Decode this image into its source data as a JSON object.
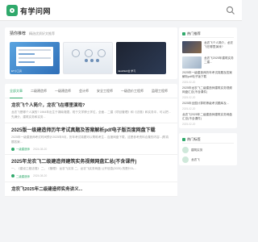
{
  "header": {
    "logo_text": "有学问网",
    "search_icon": "search-icon"
  },
  "recommend": {
    "title": "猜你推荐",
    "subtitle": "精选优质好文推荐",
    "items": [
      {
        "caption": "ET小工具"
      },
      {
        "caption": ""
      },
      {
        "caption": "JavaWeb全 学习"
      }
    ]
  },
  "tabs": [
    {
      "label": "全部文章",
      "active": true
    },
    {
      "label": "二级建造师",
      "active": false
    },
    {
      "label": "一级建造师",
      "active": false
    },
    {
      "label": "会计师",
      "active": false
    },
    {
      "label": "安全工程师",
      "active": false
    },
    {
      "label": "一级造价工程师",
      "active": false
    },
    {
      "label": "监理工程师",
      "active": false
    }
  ],
  "posts": [
    {
      "title": "龙农飞个人简介，龙农飞在哪里演戏?",
      "desc": "龙农飞是哪个人演的? 1964年出生于湖南湘潭，现于文学博士学位，全面... 二建《项目管理》和《法规》和实务中，可以把... 先满分，建筑实务和实务...",
      "tag": "",
      "date": "",
      "big": false
    },
    {
      "title": "2025版一级建造师历年考试真题及答案解析pdf电子版百度网盘下载",
      "desc": "2025年一级建造师考试时间预计2025年9月，历年考试真题可以帮助考生... 百度网盘下载，这是参考资料合集的内容...(附真题答案...",
      "tag": "一级建造师",
      "date": "2024-08-20",
      "big": true
    },
    {
      "title": "2025年龙农飞二级建造师建筑实务视频网盘汇总(不含课件)",
      "desc": "一、《建设工程法规》 二、《管理》 龙农飞实务 二、龙农飞实务网盘 公开信息(2025) 的是什么...",
      "tag": "二级建造师",
      "date": "2024-08-20",
      "big": true
    },
    {
      "title": "龙农飞2025年二级建造师实务讲义...",
      "desc": "",
      "tag": "",
      "date": "",
      "big": false
    }
  ],
  "sidebar": {
    "latest_title": "热门推荐",
    "featured": {
      "text": "龙农飞个人简介，龙农飞在哪里演戏?",
      "date": ""
    },
    "featured2": {
      "text": "龙农飞2025年建筑实务二建...",
      "date": ""
    },
    "items": [
      {
        "text": "2025年一级建造师历年考试真题及答案解析pdf电子版下载",
        "date": "2025-02-20"
      },
      {
        "text": "2025年龙农飞二级建造师建筑实务视频网盘汇总(不含课件)",
        "date": "2025-02-20"
      },
      {
        "text": "2025年全国计算机等级考试题库及...",
        "date": "2025-02-20"
      },
      {
        "text": "龙农飞2025年二级建造师建筑实务网盘汇总(不含课件)",
        "date": "2025-02-20"
      }
    ],
    "tags_title": "热门标签",
    "tags": [
      {
        "name": "建筑实务"
      },
      {
        "name": "龙农飞"
      }
    ]
  }
}
